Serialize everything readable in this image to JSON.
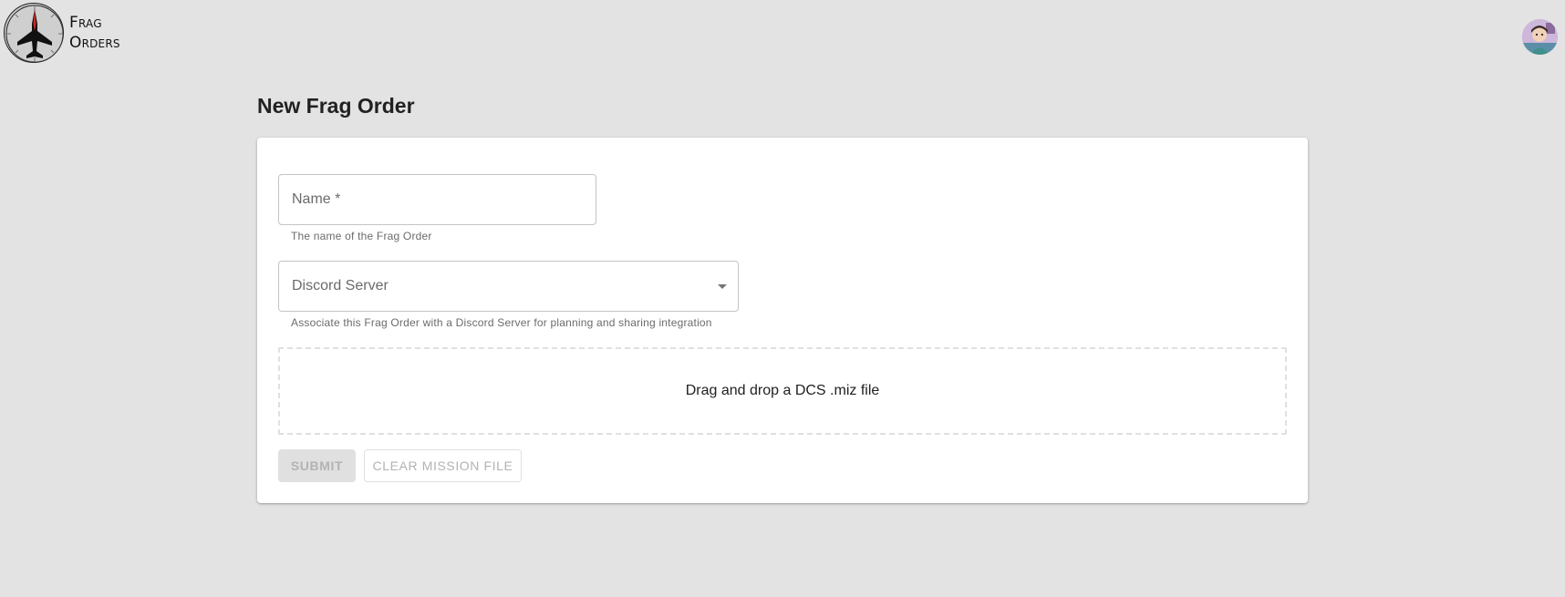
{
  "header": {
    "logo_line1": "Frag",
    "logo_line2": "Orders",
    "logo_icon": "fighter-jet-icon",
    "avatar_icon": "user-avatar"
  },
  "page": {
    "title": "New Frag Order"
  },
  "form": {
    "name_label": "Name *",
    "name_helper": "The name of the Frag Order",
    "server_label": "Discord Server",
    "server_helper": "Associate this Frag Order with a Discord Server for planning and sharing integration",
    "dropzone_text": "Drag and drop a DCS .miz file",
    "submit_label": "SUBMIT",
    "clear_label": "CLEAR MISSION FILE"
  },
  "colors": {
    "background": "#e3e3e3",
    "card": "#ffffff",
    "disabled_text": "#b3b3b3",
    "jet_accent": "#c62828"
  }
}
